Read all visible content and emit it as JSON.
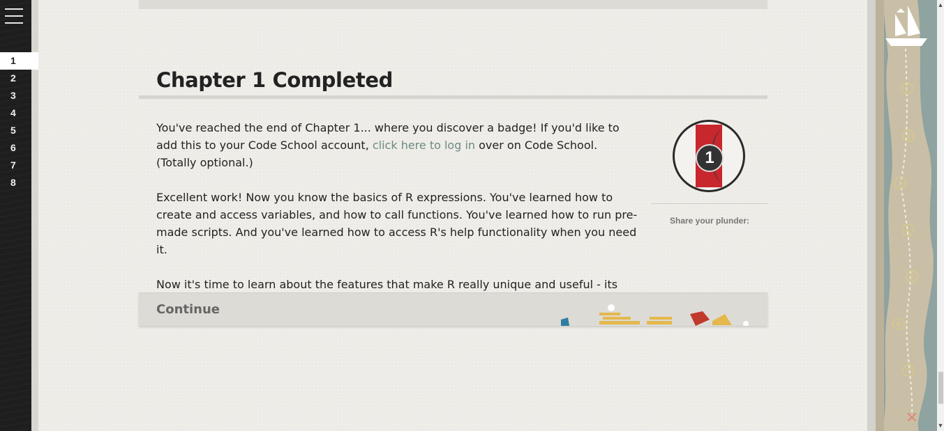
{
  "sidebar": {
    "chapters": [
      "1",
      "2",
      "3",
      "4",
      "5",
      "6",
      "7",
      "8"
    ],
    "active_chapter": "1"
  },
  "main": {
    "title": "Chapter 1 Completed",
    "para1_before": "You've reached the end of Chapter 1... where you discover a badge! If you'd like to add this to your Code School account, ",
    "para1_link": "click here to log in",
    "para1_after": " over on Code School. (Totally optional.)",
    "para2": "Excellent work! Now you know the basics of R expressions. You've learned how to create and access variables, and how to call functions. You've learned how to run pre-made scripts. And you've learned how to access R's help functionality when you need it.",
    "para3": "Now it's time to learn about the features that make R really unique and useful - its data structures. Vectors are first; we'll talk about them in the next chapter!",
    "continue_label": "Continue"
  },
  "badge": {
    "number": "1",
    "share_label": "Share your plunder:"
  },
  "map": {
    "waypoints": [
      "1",
      "2",
      "3",
      "4",
      "5",
      "6",
      "7"
    ],
    "end_marker": "✕"
  },
  "colors": {
    "link": "#6b8a84",
    "badge_red": "#c8272d",
    "map_sea": "#8fa3a0",
    "map_land": "#c9bfa6"
  }
}
